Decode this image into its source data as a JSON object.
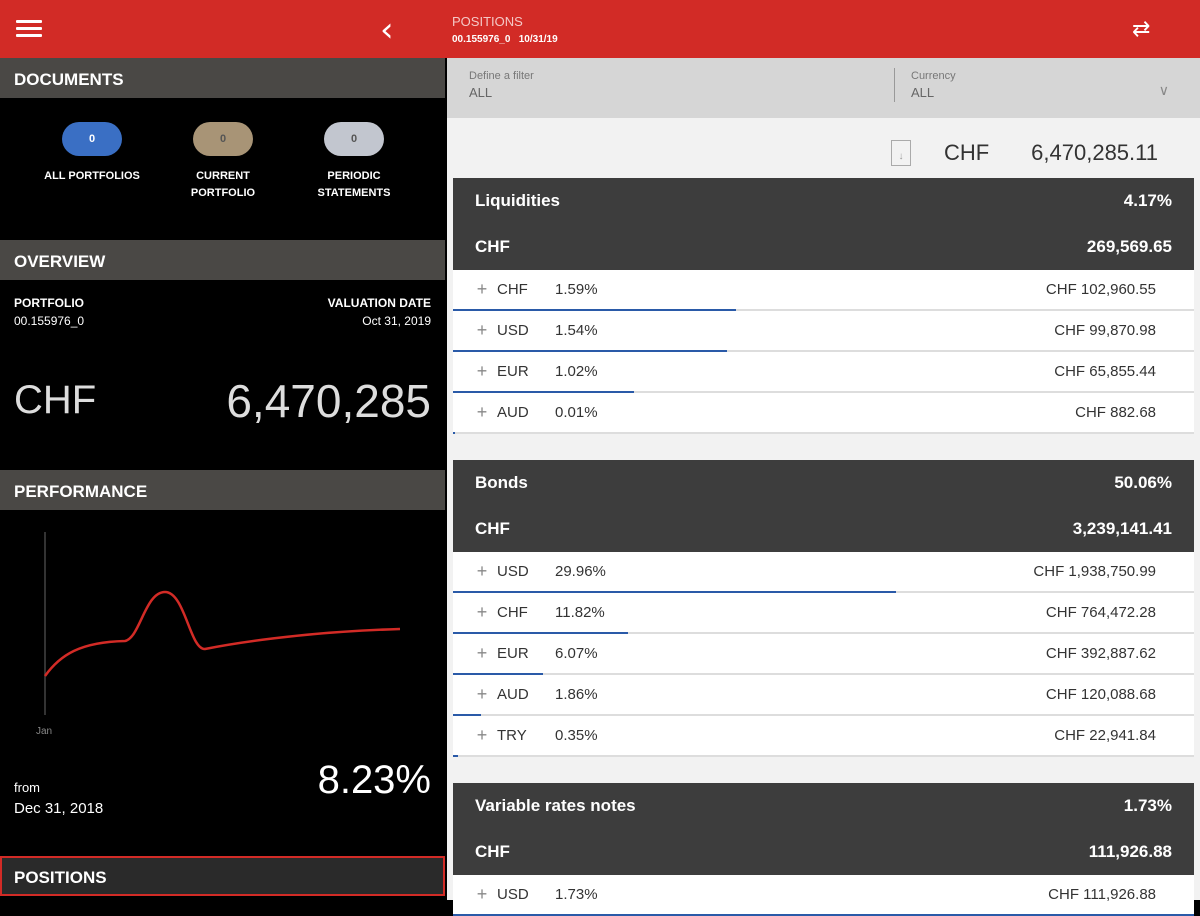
{
  "header": {
    "title": "POSITIONS",
    "subtitle": "00.155976_0   10/31/19",
    "back_icon": "chevron-left-icon",
    "swap_icon": "swap-icon"
  },
  "documents": {
    "title": "DOCUMENTS",
    "items": [
      {
        "count": "0",
        "label1": "ALL PORTFOLIOS",
        "label2": "",
        "color": "#3a6fc4"
      },
      {
        "count": "0",
        "label1": "CURRENT",
        "label2": "PORTFOLIO",
        "color": "#a89476"
      },
      {
        "count": "0",
        "label1": "PERIODIC",
        "label2": "STATEMENTS",
        "color": "#c2c6cf"
      }
    ]
  },
  "overview": {
    "title": "OVERVIEW",
    "portfolio_label": "PORTFOLIO",
    "portfolio": "00.155976_0",
    "valuation_label": "VALUATION DATE",
    "valuation_date": "Oct 31, 2019",
    "currency": "CHF",
    "value": "6,470,285"
  },
  "performance": {
    "title": "PERFORMANCE",
    "x_label": "Jan",
    "from_label": "from",
    "from_date": "Dec 31, 2018",
    "value": "8.23%",
    "line_color": "#d22b26"
  },
  "positions_nav": "POSITIONS",
  "filter": {
    "filter_label": "Define a filter",
    "filter_value": "ALL",
    "currency_label": "Currency",
    "currency_value": "ALL"
  },
  "total": {
    "currency": "CHF",
    "value": "6,470,285.11"
  },
  "sections": [
    {
      "name": "Liquidities",
      "pct": "4.17%",
      "currency": "CHF",
      "amount": "269,569.65",
      "rows": [
        {
          "cur": "CHF",
          "pct": "1.59%",
          "amt": "CHF 102,960.55"
        },
        {
          "cur": "USD",
          "pct": "1.54%",
          "amt": "CHF 99,870.98"
        },
        {
          "cur": "EUR",
          "pct": "1.02%",
          "amt": "CHF 65,855.44"
        },
        {
          "cur": "AUD",
          "pct": "0.01%",
          "amt": "CHF 882.68"
        }
      ]
    },
    {
      "name": "Bonds",
      "pct": "50.06%",
      "currency": "CHF",
      "amount": "3,239,141.41",
      "rows": [
        {
          "cur": "USD",
          "pct": "29.96%",
          "amt": "CHF 1,938,750.99"
        },
        {
          "cur": "CHF",
          "pct": "11.82%",
          "amt": "CHF 764,472.28"
        },
        {
          "cur": "EUR",
          "pct": "6.07%",
          "amt": "CHF 392,887.62"
        },
        {
          "cur": "AUD",
          "pct": "1.86%",
          "amt": "CHF 120,088.68"
        },
        {
          "cur": "TRY",
          "pct": "0.35%",
          "amt": "CHF 22,941.84"
        }
      ]
    },
    {
      "name": "Variable rates notes",
      "pct": "1.73%",
      "currency": "CHF",
      "amount": "111,926.88",
      "rows": [
        {
          "cur": "USD",
          "pct": "1.73%",
          "amt": "CHF 111,926.88"
        }
      ]
    }
  ]
}
